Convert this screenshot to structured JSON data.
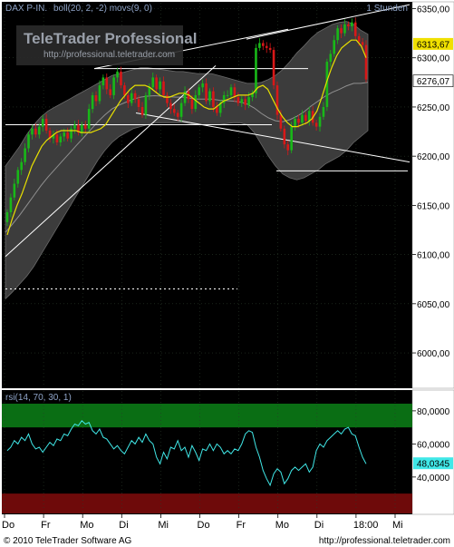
{
  "header": {
    "instrument": "DAX P-IN.",
    "indicators": "boll(20, 2, -2) movs(9, 0)",
    "interval": "1 Stunden"
  },
  "watermark": {
    "line1": "TeleTrader Professional",
    "line2": "http://professional.teletrader.com"
  },
  "rsi_header": "rsi(14, 70, 30, 1)",
  "footer": {
    "copyright": "© 2010 TeleTrader Software AG",
    "url": "http://professional.teletrader.com"
  },
  "colors": {
    "background": "#000000",
    "band_fill": "#3c3c3c",
    "up_candle": "#18b818",
    "down_candle": "#d81818",
    "moving_average": "#e8e000",
    "middle_band": "#909090",
    "rsi_line": "#40e8e8",
    "overbought_zone": "#0a6e14",
    "oversold_zone": "#6e0a0a",
    "price_marker": "#f0e000",
    "rsi_marker": "#40e8e8"
  },
  "price_markers": {
    "last_price": "6313,67",
    "secondary": "6276,07"
  },
  "rsi_marker": "48,0345",
  "chart_data": [
    {
      "type": "candlestick",
      "title": "DAX P-IN.",
      "interval": "1 Stunden",
      "ylim": [
        5965,
        6356
      ],
      "y_ticks": [
        "6350,00",
        "6300,00",
        "6250,00",
        "6200,00",
        "6150,00",
        "6100,00",
        "6050,00",
        "6000,00"
      ],
      "y_tick_values": [
        6350,
        6300,
        6250,
        6200,
        6150,
        6100,
        6050,
        6000
      ],
      "x_ticks": [
        "Do",
        "Fr",
        "Mo",
        "Di",
        "Mi",
        "Do",
        "Fr",
        "Mo",
        "Di",
        "18:00",
        "Mi"
      ],
      "close": [
        6143,
        6158,
        6172,
        6186,
        6194,
        6208,
        6222,
        6228,
        6222,
        6230,
        6238,
        6226,
        6218,
        6222,
        6214,
        6220,
        6224,
        6218,
        6228,
        6232,
        6224,
        6232,
        6228,
        6248,
        6262,
        6256,
        6272,
        6280,
        6268,
        6262,
        6280,
        6286,
        6272,
        6262,
        6254,
        6264,
        6258,
        6250,
        6242,
        6262,
        6270,
        6280,
        6268,
        6276,
        6262,
        6254,
        6248,
        6244,
        6240,
        6254,
        6266,
        6258,
        6248,
        6262,
        6270,
        6274,
        6256,
        6266,
        6250,
        6244,
        6254,
        6262,
        6262,
        6270,
        6260,
        6254,
        6258,
        6252,
        6260,
        6264,
        6310,
        6315,
        6312,
        6310,
        6308,
        6272,
        6242,
        6228,
        6212,
        6206,
        6230,
        6238,
        6234,
        6242,
        6236,
        6246,
        6234,
        6230,
        6240,
        6250,
        6296,
        6304,
        6318,
        6330,
        6325,
        6334,
        6332,
        6336,
        6322,
        6316,
        6313,
        6278
      ],
      "series": [
        {
          "name": "boll(20, 2, -2)",
          "kind": "band",
          "upper": [
            6190,
            6200,
            6210,
            6222,
            6232,
            6240,
            6246,
            6250,
            6254,
            6258,
            6262,
            6266,
            6270,
            6274,
            6278,
            6282,
            6284,
            6286,
            6288,
            6290,
            6290,
            6289,
            6288,
            6287,
            6286,
            6286,
            6285,
            6284,
            6284,
            6284,
            6282,
            6280,
            6278,
            6276,
            6274,
            6274,
            6275,
            6278,
            6282,
            6288,
            6296,
            6305,
            6312,
            6320,
            6326,
            6330,
            6334,
            6336,
            6337,
            6334,
            6328,
            6324
          ],
          "lower": [
            6055,
            6062,
            6070,
            6078,
            6088,
            6100,
            6112,
            6124,
            6136,
            6148,
            6160,
            6172,
            6184,
            6196,
            6206,
            6214,
            6220,
            6224,
            6228,
            6230,
            6232,
            6234,
            6234,
            6234,
            6234,
            6234,
            6233,
            6232,
            6232,
            6232,
            6232,
            6233,
            6234,
            6234,
            6232,
            6224,
            6212,
            6200,
            6190,
            6182,
            6178,
            6176,
            6178,
            6182,
            6186,
            6192,
            6196,
            6200,
            6206,
            6214,
            6220,
            6226
          ]
        },
        {
          "name": "movs(9, 0)",
          "kind": "line",
          "values": [
            6120,
            6136,
            6150,
            6162,
            6176,
            6190,
            6200,
            6210,
            6216,
            6220,
            6224,
            6226,
            6226,
            6226,
            6226,
            6224,
            6224,
            6224,
            6226,
            6228,
            6232,
            6240,
            6248,
            6256,
            6262,
            6268,
            6272,
            6272,
            6272,
            6270,
            6266,
            6262,
            6260,
            6260,
            6262,
            6264,
            6264,
            6262,
            6258,
            6254,
            6250,
            6248,
            6248,
            6252,
            6256,
            6258,
            6260,
            6262,
            6262,
            6262,
            6264,
            6270,
            6272,
            6268,
            6258,
            6248,
            6240,
            6234,
            6230,
            6230,
            6232,
            6234,
            6238,
            6246,
            6260,
            6276,
            6290,
            6302,
            6310,
            6314,
            6318,
            6318,
            6312,
            6300
          ]
        }
      ]
    },
    {
      "type": "line",
      "title": "rsi(14, 70, 30, 1)",
      "ylim": [
        18,
        92
      ],
      "y_ticks": [
        "80,0000",
        "60,0000",
        "40,0000"
      ],
      "y_tick_values": [
        80,
        60,
        40
      ],
      "overbought": 70,
      "oversold": 30,
      "series": [
        {
          "name": "rsi(14, 70, 30, 1)",
          "values": [
            56,
            58,
            62,
            60,
            64,
            62,
            66,
            60,
            57,
            58,
            55,
            58,
            61,
            59,
            63,
            62,
            66,
            65,
            69,
            72,
            71,
            74,
            72,
            73,
            68,
            66,
            69,
            64,
            63,
            60,
            57,
            59,
            56,
            54,
            58,
            62,
            60,
            64,
            61,
            66,
            62,
            60,
            52,
            48,
            55,
            51,
            58,
            57,
            62,
            56,
            58,
            52,
            59,
            55,
            50,
            57,
            56,
            60,
            56,
            60,
            58,
            54,
            56,
            54,
            57,
            56,
            60,
            66,
            68,
            67,
            58,
            52,
            44,
            39,
            35,
            42,
            45,
            43,
            36,
            39,
            44,
            46,
            44,
            46,
            48,
            43,
            46,
            56,
            60,
            58,
            62,
            64,
            66,
            68,
            66,
            69,
            70,
            66,
            65,
            58,
            52,
            48
          ]
        }
      ]
    }
  ]
}
